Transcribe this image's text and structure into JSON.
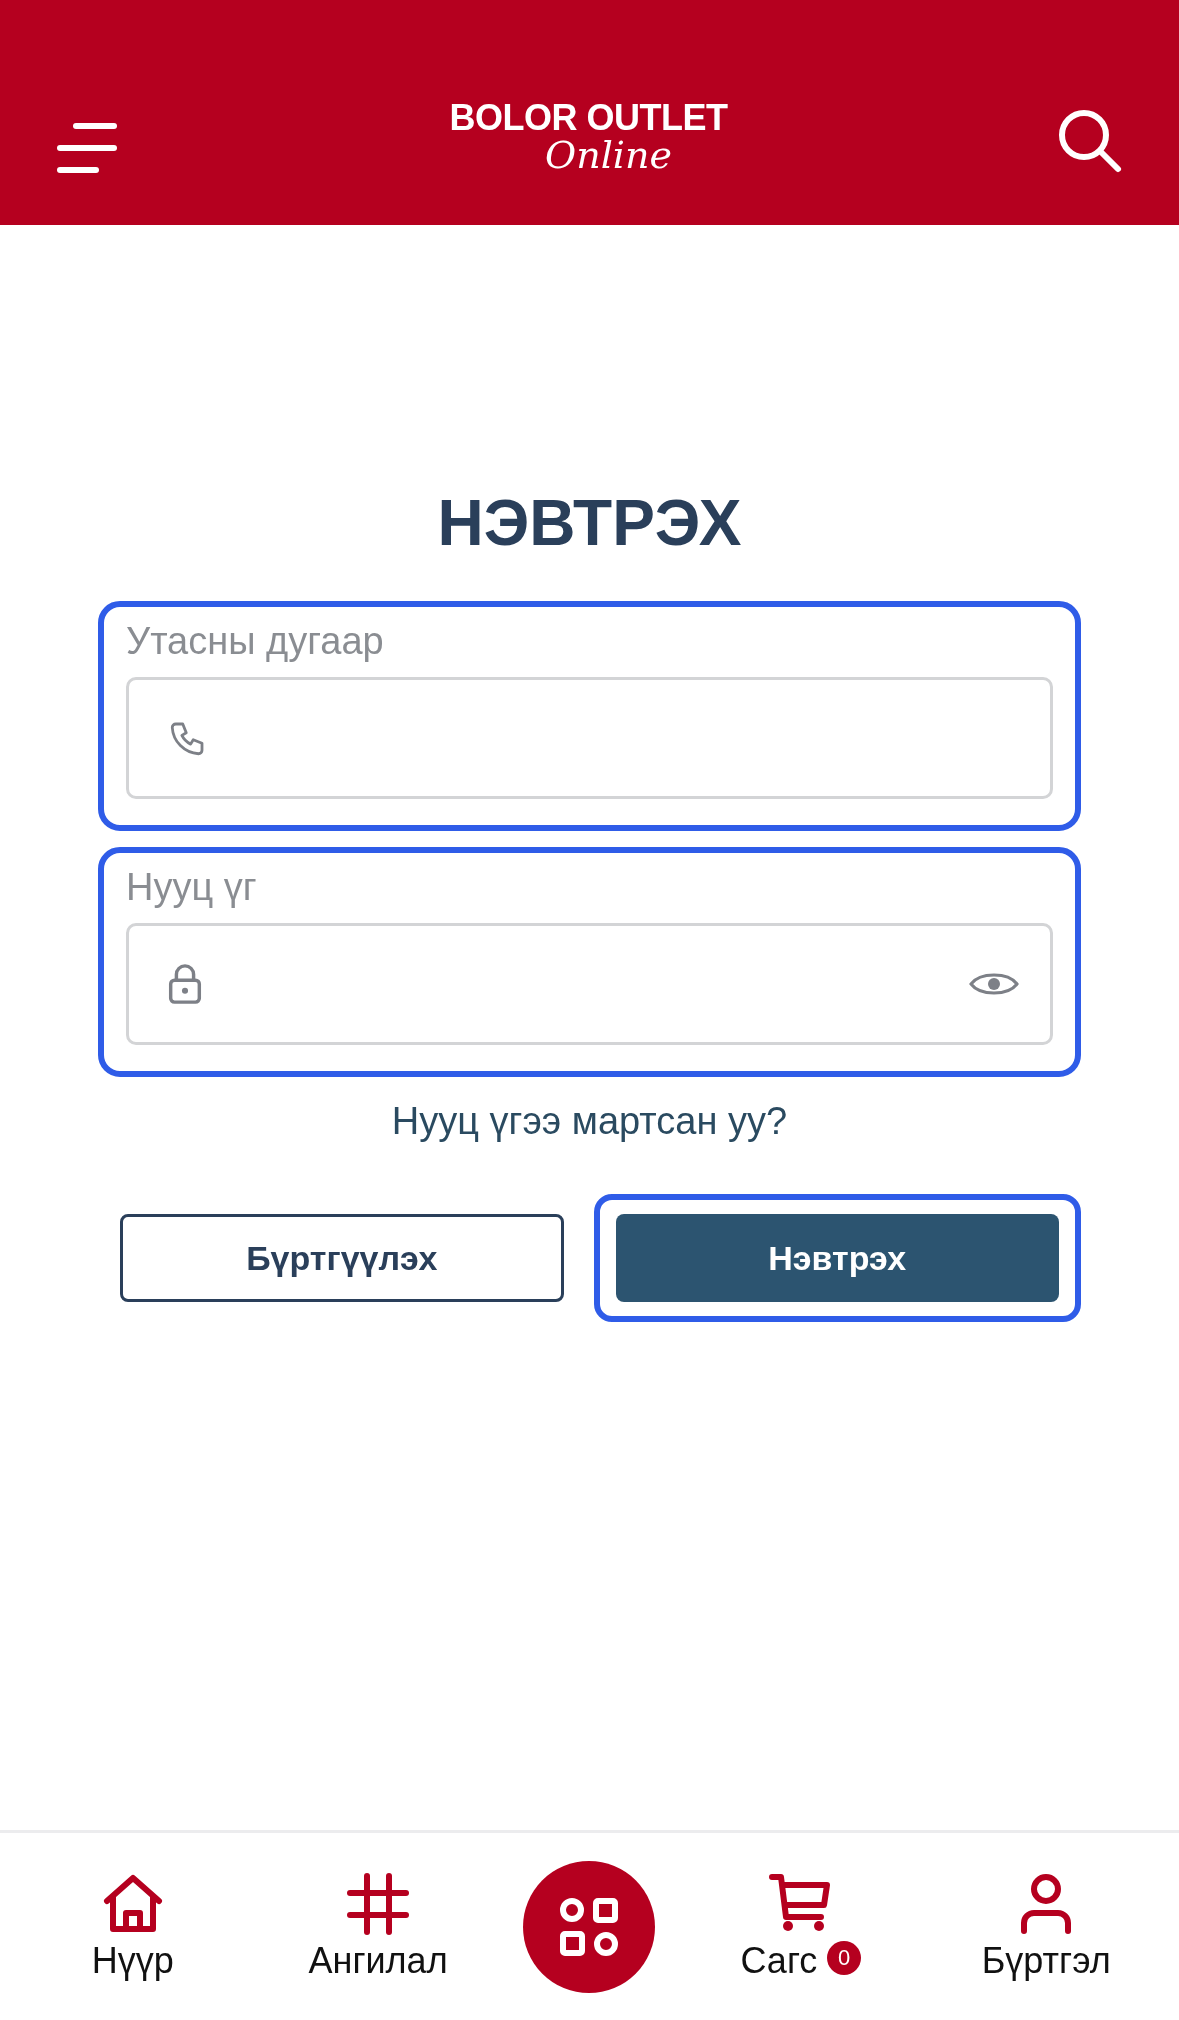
{
  "header": {
    "logo_line_1": "BOLOR OUTLET",
    "logo_line_2": "Online"
  },
  "title": "НЭВТРЭХ",
  "fields": [
    {
      "label": "Утасны дугаар",
      "kind": "phone",
      "highlighted": true
    },
    {
      "label": "Нууц үг",
      "kind": "password",
      "highlighted": true
    }
  ],
  "forgot_link": "Нууц үгээ мартсан уу?",
  "buttons": [
    {
      "label": "Бүртгүүлэх",
      "kind": "outline",
      "highlighted": false
    },
    {
      "label": "Нэвтрэх",
      "kind": "primary",
      "highlighted": true
    }
  ],
  "bottom_nav": [
    {
      "kind": "home",
      "label": "Нүүр"
    },
    {
      "kind": "hash",
      "label": "Ангилал"
    },
    {
      "kind": "center"
    },
    {
      "kind": "cart",
      "label": "Сагс",
      "badge": "0"
    },
    {
      "kind": "user",
      "label": "Бүртгэл"
    }
  ]
}
